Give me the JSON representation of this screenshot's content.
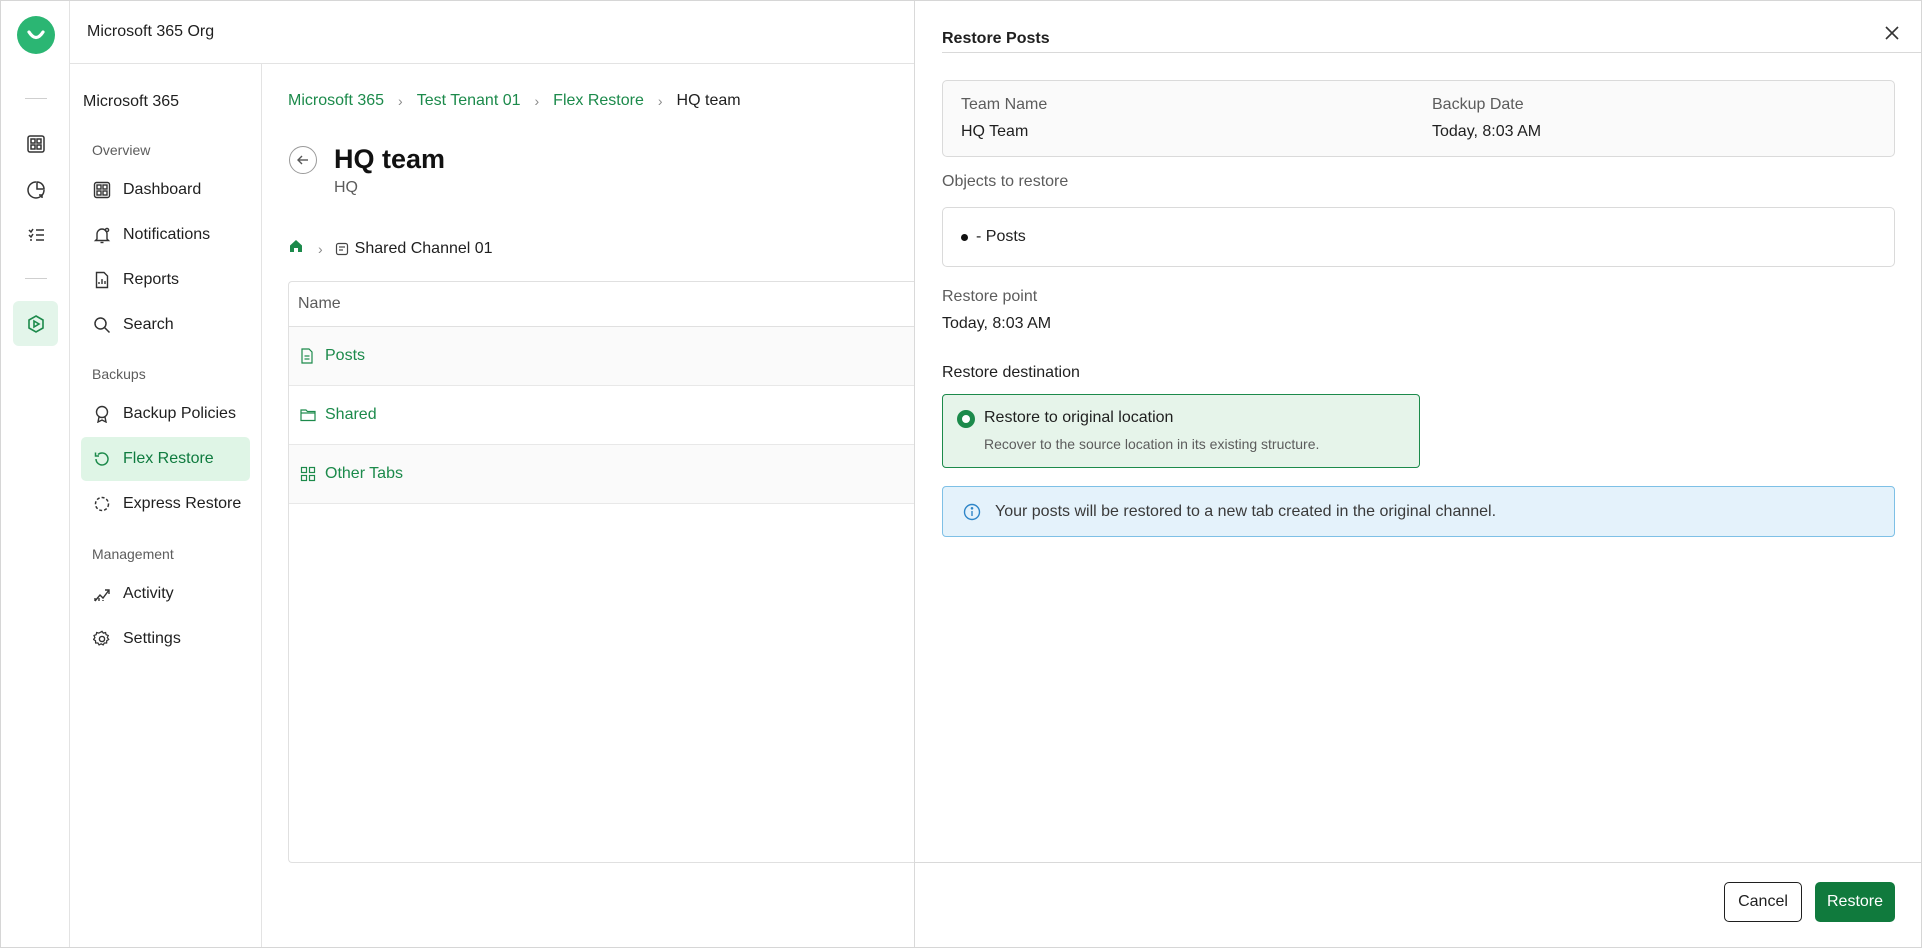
{
  "app": {
    "org_name": "Microsoft 365 Org"
  },
  "colors": {
    "accent": "#1c8a4b",
    "primary_button": "#107a3d",
    "active_bg": "#dff5e6",
    "info_bg": "#e4f2fb",
    "logo": "#2bb673"
  },
  "rail": {
    "icons": [
      "check-logo-icon",
      "dashboard-icon",
      "reports-chart-icon",
      "tasks-list-icon",
      "flex-restore-icon"
    ]
  },
  "sidebar": {
    "title": "Microsoft 365",
    "sections": {
      "overview": "Overview",
      "backups": "Backups",
      "management": "Management"
    },
    "items": [
      {
        "label": "Dashboard",
        "icon": "dashboard-icon"
      },
      {
        "label": "Notifications",
        "icon": "bell-icon"
      },
      {
        "label": "Reports",
        "icon": "report-icon"
      },
      {
        "label": "Search",
        "icon": "search-icon"
      },
      {
        "label": "Backup Policies",
        "icon": "policy-icon"
      },
      {
        "label": "Flex Restore",
        "icon": "restore-icon",
        "active": true
      },
      {
        "label": "Express Restore",
        "icon": "express-restore-icon"
      },
      {
        "label": "Activity",
        "icon": "activity-icon"
      },
      {
        "label": "Settings",
        "icon": "gear-icon"
      }
    ]
  },
  "main": {
    "breadcrumbs": [
      "Microsoft 365",
      "Test Tenant 01",
      "Flex Restore",
      "HQ team"
    ],
    "title": "HQ team",
    "subtitle": "HQ",
    "location": {
      "channel": "Shared Channel 01"
    },
    "table": {
      "header": "Name",
      "rows": [
        {
          "name": "Posts",
          "icon": "document-icon"
        },
        {
          "name": "Shared",
          "icon": "folder-icon"
        },
        {
          "name": "Other Tabs",
          "icon": "grid-icon"
        }
      ]
    }
  },
  "panel": {
    "title": "Restore Posts",
    "team_name_label": "Team Name",
    "team_name": "HQ Team",
    "backup_date_label": "Backup Date",
    "backup_date": "Today, 8:03 AM",
    "objects_label": "Objects to restore",
    "objects": [
      "- Posts"
    ],
    "restore_point_label": "Restore point",
    "restore_point": "Today, 8:03 AM",
    "destination_label": "Restore destination",
    "destination_option_title": "Restore to original location",
    "destination_option_desc": "Recover to the source location in its existing structure.",
    "info_message": "Your posts will be restored to a new tab created in the original channel.",
    "cancel_label": "Cancel",
    "restore_label": "Restore"
  }
}
